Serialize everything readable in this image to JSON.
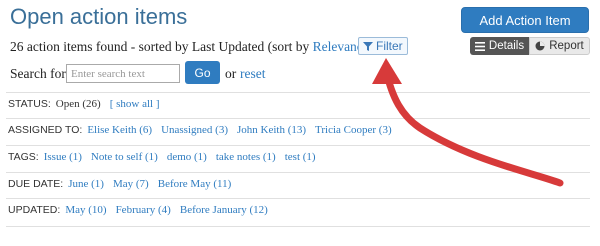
{
  "header": {
    "title": "Open action items",
    "add_button": "Add Action Item"
  },
  "summary": {
    "prefix": "26 action items found - sorted by Last Updated (sort by ",
    "sort_link": "Relevance",
    "suffix": ")",
    "filter_label": "Filter"
  },
  "view_toggle": {
    "details_label": "Details",
    "report_label": "Report"
  },
  "search": {
    "label": "Search for:",
    "placeholder": "Enter search text",
    "go_label": "Go",
    "or_text": "or",
    "reset_label": "reset"
  },
  "filters": {
    "status": {
      "label": "STATUS:",
      "value": "Open (26)",
      "show_all": "[ show all ]"
    },
    "assigned": {
      "label": "ASSIGNED TO:",
      "items": [
        "Elise Keith (6)",
        "Unassigned (3)",
        "John Keith (13)",
        "Tricia Cooper (3)"
      ]
    },
    "tags": {
      "label": "TAGS:",
      "items": [
        "Issue (1)",
        "Note to self (1)",
        "demo (1)",
        "take notes (1)",
        "test (1)"
      ]
    },
    "due_date": {
      "label": "DUE DATE:",
      "items": [
        "June (1)",
        "May (7)",
        "Before May (11)"
      ]
    },
    "updated": {
      "label": "UPDATED:",
      "items": [
        "May (10)",
        "February (4)",
        "Before January (12)"
      ]
    }
  },
  "colors": {
    "accent": "#2f7cc0",
    "title": "#3a6f98",
    "arrow": "#d73a3a"
  }
}
